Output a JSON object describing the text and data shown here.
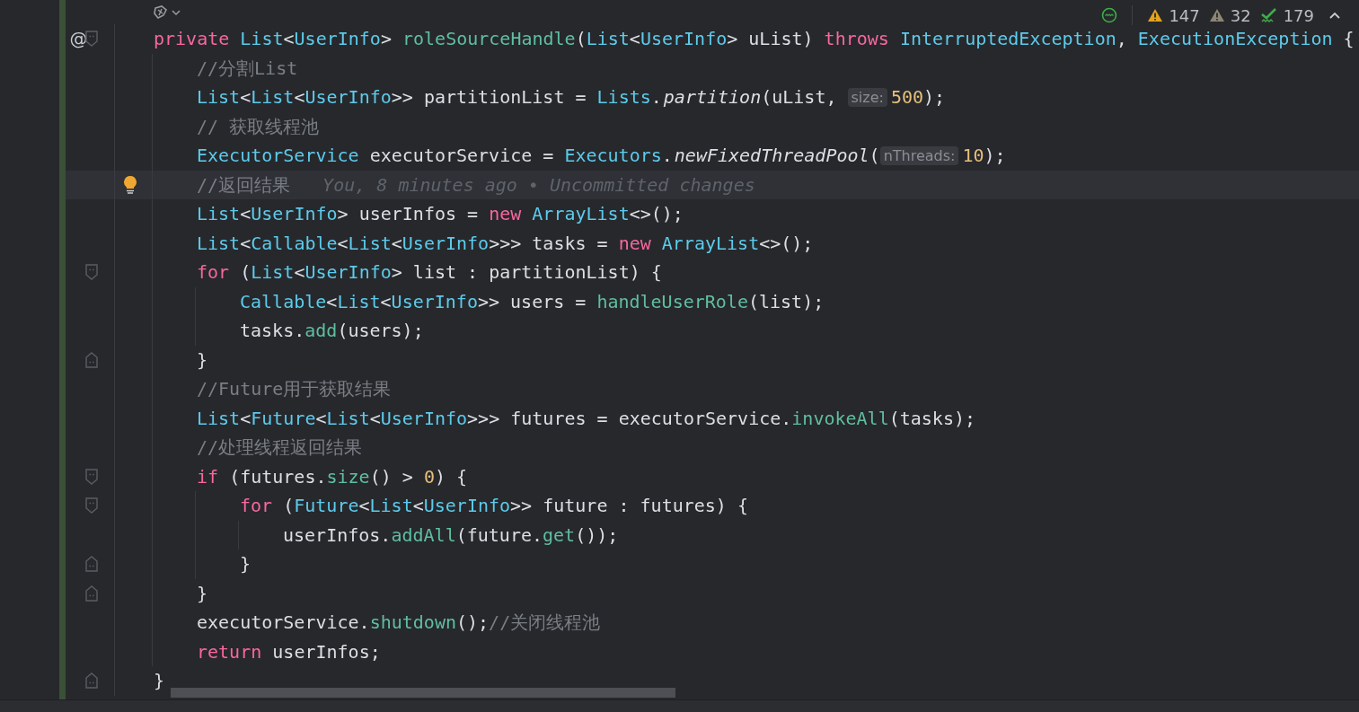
{
  "inspections": [
    {
      "kind": "ok"
    },
    {
      "kind": "warning",
      "count": "147"
    },
    {
      "kind": "weak",
      "count": "32"
    },
    {
      "kind": "typo",
      "count": "179"
    }
  ],
  "lines": [
    {
      "kind": "opener",
      "gutter_mark": "@",
      "current": false,
      "tokens": [
        {
          "kind": "kw",
          "text": "private "
        },
        {
          "kind": "type",
          "text": "List"
        },
        {
          "kind": "plain",
          "text": "<"
        },
        {
          "kind": "type",
          "text": "UserInfo"
        },
        {
          "kind": "plain",
          "text": "> "
        },
        {
          "kind": "decl",
          "text": "roleSourceHandle"
        },
        {
          "kind": "plain",
          "text": "("
        },
        {
          "kind": "type",
          "text": "List"
        },
        {
          "kind": "plain",
          "text": "<"
        },
        {
          "kind": "type",
          "text": "UserInfo"
        },
        {
          "kind": "plain",
          "text": "> uList) "
        },
        {
          "kind": "kw",
          "text": "throws "
        },
        {
          "kind": "type",
          "text": "InterruptedException"
        },
        {
          "kind": "plain",
          "text": ", "
        },
        {
          "kind": "type",
          "text": "ExecutionException"
        },
        {
          "kind": "plain",
          "text": " {"
        }
      ],
      "children": [
        {
          "current": false,
          "tokens": [
            {
              "kind": "comment",
              "text": "//分割List"
            }
          ]
        },
        {
          "current": false,
          "tokens": [
            {
              "kind": "type",
              "text": "List"
            },
            {
              "kind": "plain",
              "text": "<"
            },
            {
              "kind": "type",
              "text": "List"
            },
            {
              "kind": "plain",
              "text": "<"
            },
            {
              "kind": "type",
              "text": "UserInfo"
            },
            {
              "kind": "plain",
              "text": ">> partitionList = "
            },
            {
              "kind": "type",
              "text": "Lists"
            },
            {
              "kind": "plain",
              "text": "."
            },
            {
              "kind": "static",
              "text": "partition"
            },
            {
              "kind": "plain",
              "text": "(uList, "
            },
            {
              "kind": "hint",
              "text": "size:"
            },
            {
              "kind": "num",
              "text": "500"
            },
            {
              "kind": "plain",
              "text": ");"
            }
          ]
        },
        {
          "current": false,
          "tokens": [
            {
              "kind": "comment",
              "text": "// 获取线程池"
            }
          ]
        },
        {
          "current": false,
          "tokens": [
            {
              "kind": "type",
              "text": "ExecutorService"
            },
            {
              "kind": "plain",
              "text": " executorService = "
            },
            {
              "kind": "type",
              "text": "Executors"
            },
            {
              "kind": "plain",
              "text": "."
            },
            {
              "kind": "static",
              "text": "newFixedThreadPool"
            },
            {
              "kind": "plain",
              "text": "("
            },
            {
              "kind": "hint",
              "text": "nThreads:"
            },
            {
              "kind": "num",
              "text": "10"
            },
            {
              "kind": "plain",
              "text": ");"
            }
          ]
        },
        {
          "current": true,
          "blame": "You, 8 minutes ago • Uncommitted changes",
          "tokens": [
            {
              "kind": "comment",
              "text": "//返回结果"
            }
          ]
        },
        {
          "current": false,
          "tokens": [
            {
              "kind": "type",
              "text": "List"
            },
            {
              "kind": "plain",
              "text": "<"
            },
            {
              "kind": "type",
              "text": "UserInfo"
            },
            {
              "kind": "plain",
              "text": "> userInfos = "
            },
            {
              "kind": "kw",
              "text": "new "
            },
            {
              "kind": "type",
              "text": "ArrayList"
            },
            {
              "kind": "plain",
              "text": "<>();"
            }
          ]
        },
        {
          "current": false,
          "tokens": [
            {
              "kind": "type",
              "text": "List"
            },
            {
              "kind": "plain",
              "text": "<"
            },
            {
              "kind": "type",
              "text": "Callable"
            },
            {
              "kind": "plain",
              "text": "<"
            },
            {
              "kind": "type",
              "text": "List"
            },
            {
              "kind": "plain",
              "text": "<"
            },
            {
              "kind": "type",
              "text": "UserInfo"
            },
            {
              "kind": "plain",
              "text": ">>> tasks = "
            },
            {
              "kind": "kw",
              "text": "new "
            },
            {
              "kind": "type",
              "text": "ArrayList"
            },
            {
              "kind": "plain",
              "text": "<>();"
            }
          ]
        },
        {
          "kind": "opener",
          "current": false,
          "tokens": [
            {
              "kind": "kw",
              "text": "for "
            },
            {
              "kind": "plain",
              "text": "("
            },
            {
              "kind": "type",
              "text": "List"
            },
            {
              "kind": "plain",
              "text": "<"
            },
            {
              "kind": "type",
              "text": "UserInfo"
            },
            {
              "kind": "plain",
              "text": "> list : partitionList) {"
            }
          ],
          "children": [
            {
              "current": false,
              "tokens": [
                {
                  "kind": "type",
                  "text": "Callable"
                },
                {
                  "kind": "plain",
                  "text": "<"
                },
                {
                  "kind": "type",
                  "text": "List"
                },
                {
                  "kind": "plain",
                  "text": "<"
                },
                {
                  "kind": "type",
                  "text": "UserInfo"
                },
                {
                  "kind": "plain",
                  "text": ">> users = "
                },
                {
                  "kind": "call",
                  "text": "handleUserRole"
                },
                {
                  "kind": "plain",
                  "text": "(list);"
                }
              ]
            },
            {
              "current": false,
              "tokens": [
                {
                  "kind": "plain",
                  "text": "tasks."
                },
                {
                  "kind": "call",
                  "text": "add"
                },
                {
                  "kind": "plain",
                  "text": "(users);"
                }
              ]
            }
          ]
        },
        {
          "kind": "closer",
          "current": false,
          "tokens": [
            {
              "kind": "plain",
              "text": "}"
            }
          ]
        },
        {
          "current": false,
          "tokens": [
            {
              "kind": "comment",
              "text": "//Future用于获取结果"
            }
          ]
        },
        {
          "current": false,
          "tokens": [
            {
              "kind": "type",
              "text": "List"
            },
            {
              "kind": "plain",
              "text": "<"
            },
            {
              "kind": "type",
              "text": "Future"
            },
            {
              "kind": "plain",
              "text": "<"
            },
            {
              "kind": "type",
              "text": "List"
            },
            {
              "kind": "plain",
              "text": "<"
            },
            {
              "kind": "type",
              "text": "UserInfo"
            },
            {
              "kind": "plain",
              "text": ">>> futures = executorService."
            },
            {
              "kind": "call",
              "text": "invokeAll"
            },
            {
              "kind": "plain",
              "text": "(tasks);"
            }
          ]
        },
        {
          "current": false,
          "tokens": [
            {
              "kind": "comment",
              "text": "//处理线程返回结果"
            }
          ]
        },
        {
          "kind": "opener",
          "current": false,
          "tokens": [
            {
              "kind": "kw",
              "text": "if "
            },
            {
              "kind": "plain",
              "text": "(futures."
            },
            {
              "kind": "call",
              "text": "size"
            },
            {
              "kind": "plain",
              "text": "() > "
            },
            {
              "kind": "num",
              "text": "0"
            },
            {
              "kind": "plain",
              "text": ") {"
            }
          ],
          "children": [
            {
              "kind": "opener",
              "current": false,
              "tokens": [
                {
                  "kind": "kw",
                  "text": "for "
                },
                {
                  "kind": "plain",
                  "text": "("
                },
                {
                  "kind": "type",
                  "text": "Future"
                },
                {
                  "kind": "plain",
                  "text": "<"
                },
                {
                  "kind": "type",
                  "text": "List"
                },
                {
                  "kind": "plain",
                  "text": "<"
                },
                {
                  "kind": "type",
                  "text": "UserInfo"
                },
                {
                  "kind": "plain",
                  "text": ">> future : futures) {"
                }
              ],
              "children": [
                {
                  "current": false,
                  "tokens": [
                    {
                      "kind": "plain",
                      "text": "userInfos."
                    },
                    {
                      "kind": "call",
                      "text": "addAll"
                    },
                    {
                      "kind": "plain",
                      "text": "(future."
                    },
                    {
                      "kind": "call",
                      "text": "get"
                    },
                    {
                      "kind": "plain",
                      "text": "());"
                    }
                  ]
                }
              ]
            },
            {
              "kind": "closer",
              "current": false,
              "tokens": [
                {
                  "kind": "plain",
                  "text": "}"
                }
              ]
            }
          ]
        },
        {
          "kind": "closer",
          "current": false,
          "tokens": [
            {
              "kind": "plain",
              "text": "}"
            }
          ]
        },
        {
          "current": false,
          "tokens": [
            {
              "kind": "plain",
              "text": "executorService."
            },
            {
              "kind": "call",
              "text": "shutdown"
            },
            {
              "kind": "plain",
              "text": "();"
            },
            {
              "kind": "comment",
              "text": "//关闭线程池"
            }
          ]
        },
        {
          "current": false,
          "tokens": [
            {
              "kind": "kw",
              "text": "return "
            },
            {
              "kind": "plain",
              "text": "userInfos;"
            }
          ]
        }
      ]
    },
    {
      "kind": "closer",
      "current": false,
      "tokens": [
        {
          "kind": "plain",
          "text": "}"
        }
      ]
    }
  ]
}
